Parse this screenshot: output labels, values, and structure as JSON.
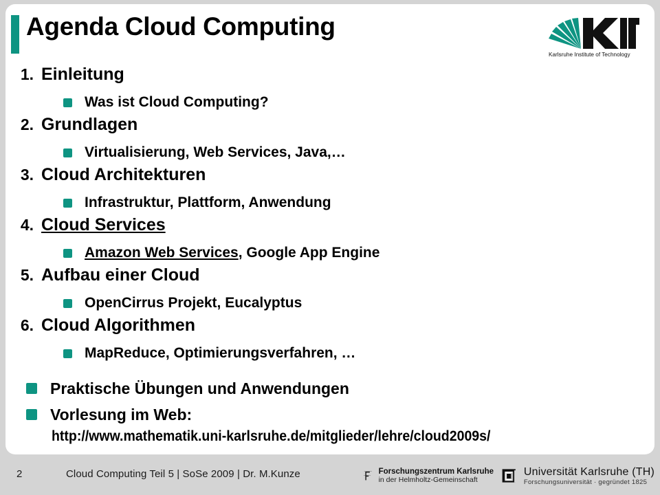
{
  "slide": {
    "title": "Agenda Cloud Computing",
    "accent_color": "#0e9482",
    "page_background": "#d4d4d4",
    "card_background": "#ffffff"
  },
  "kit_logo": {
    "wordmark": "KIT",
    "tagline": "Karlsruhe Institute of Technology",
    "ray_color": "#0e9482"
  },
  "agenda": [
    {
      "index": "1.",
      "label": "Einleitung",
      "underlined": false,
      "sub_prefix": "",
      "sub_prefix_underlined": "Was ist Cloud Computing?",
      "sub": "Was ist Cloud Computing?"
    },
    {
      "index": "2.",
      "label": "Grundlagen",
      "underlined": false,
      "sub": "Virtualisierung, Web Services, Java,…"
    },
    {
      "index": "3.",
      "label": "Cloud Architekturen",
      "underlined": false,
      "sub": "Infrastruktur, Plattform, Anwendung"
    },
    {
      "index": "4.",
      "label": "Cloud Services",
      "underlined": true,
      "sub_underlined_part": "Amazon Web Services",
      "sub_rest": ", Google App Engine",
      "sub": "Amazon Web Services, Google App Engine"
    },
    {
      "index": "5.",
      "label": "Aufbau einer Cloud",
      "underlined": false,
      "sub": "OpenCirrus Projekt, Eucalyptus"
    },
    {
      "index": "6.",
      "label": "Cloud Algorithmen",
      "underlined": false,
      "sub": "MapReduce, Optimierungsverfahren, …"
    }
  ],
  "notes": [
    {
      "label": "Praktische Übungen und Anwendungen"
    },
    {
      "label": "Vorlesung im Web:"
    }
  ],
  "url": "http://www.mathematik.uni-karlsruhe.de/mitglieder/lehre/cloud2009s/",
  "footer": {
    "page_number": "2",
    "caption": "Cloud Computing Teil 5 | SoSe 2009 | Dr. M.Kunze",
    "fzk_logo": {
      "line1": "Forschungszentrum Karlsruhe",
      "line2": "in der Helmholtz-Gemeinschaft"
    },
    "uka_logo": {
      "line1": "Universität Karlsruhe (TH)",
      "line2": "Forschungsuniversität · gegründet 1825"
    }
  }
}
